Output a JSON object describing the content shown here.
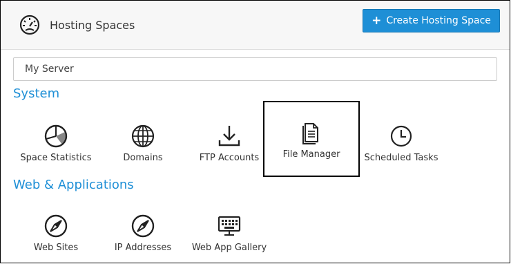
{
  "header": {
    "title": "Hosting Spaces",
    "create_button_label": "Create Hosting Space",
    "icon": "dashboard-gauge-icon"
  },
  "server_field": {
    "value": "My Server"
  },
  "sections": [
    {
      "title": "System",
      "items": [
        {
          "label": "Space Statistics",
          "icon": "pie-chart-icon"
        },
        {
          "label": "Domains",
          "icon": "globe-icon"
        },
        {
          "label": "FTP Accounts",
          "icon": "download-tray-icon"
        },
        {
          "label": "File Manager",
          "icon": "documents-icon",
          "focused": true
        },
        {
          "label": "Scheduled Tasks",
          "icon": "clock-icon"
        }
      ]
    },
    {
      "title": "Web & Applications",
      "items": [
        {
          "label": "Web Sites",
          "icon": "compass-icon"
        },
        {
          "label": "IP Addresses",
          "icon": "compass-icon"
        },
        {
          "label": "Web App Gallery",
          "icon": "keyboard-icon"
        }
      ]
    }
  ],
  "colors": {
    "accent": "#1e8fd6",
    "header_bg": "#f7f7f7",
    "text": "#333333"
  }
}
